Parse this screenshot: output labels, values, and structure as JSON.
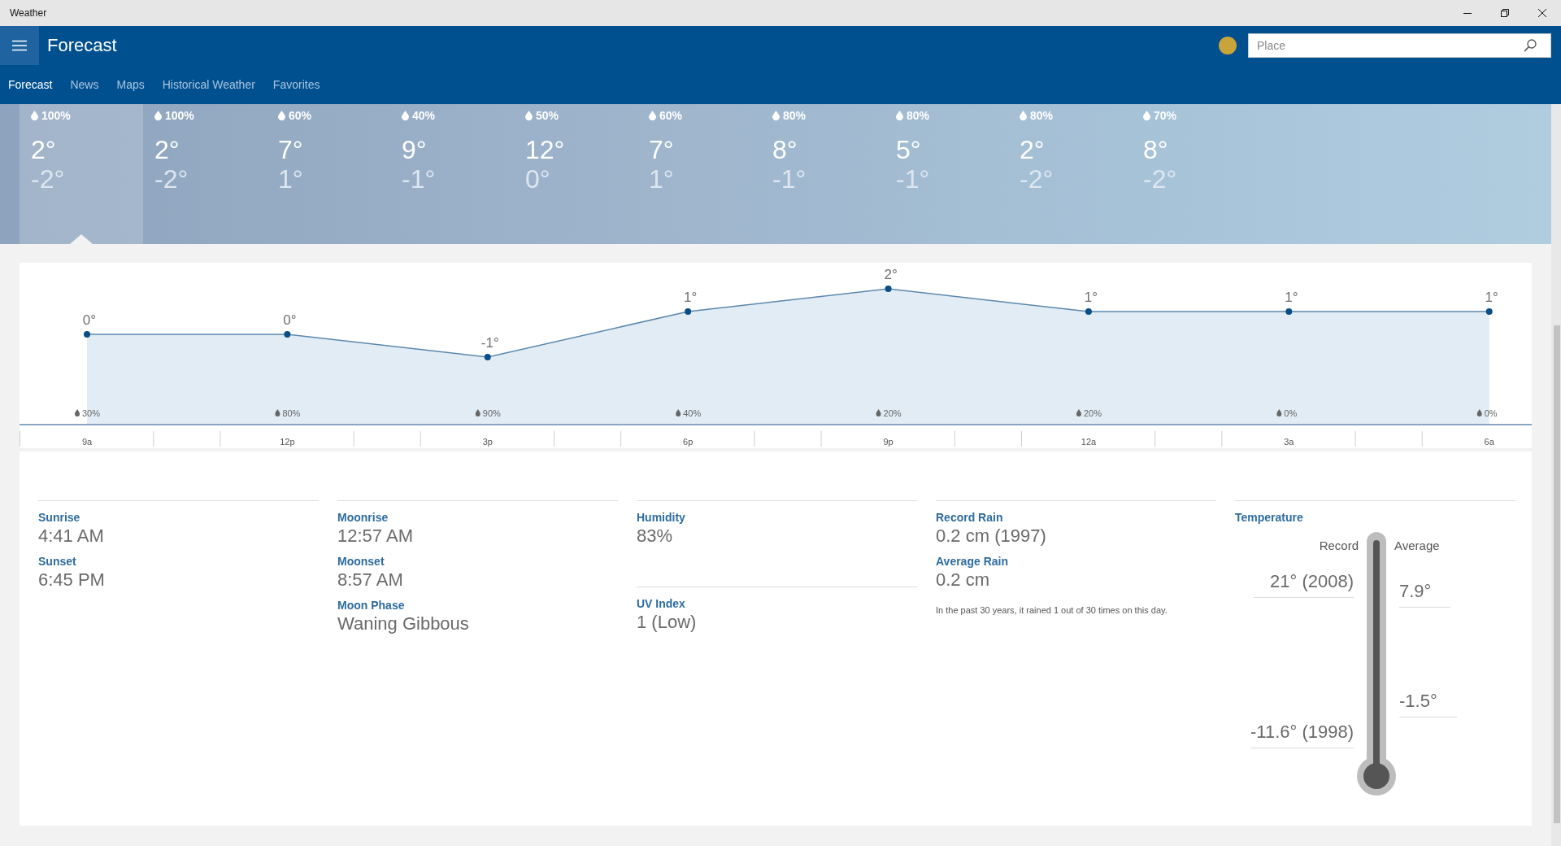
{
  "window": {
    "title": "Weather"
  },
  "header": {
    "title": "Forecast",
    "search": {
      "placeholder": "Place"
    }
  },
  "tabs": [
    {
      "label": "Forecast",
      "selected": true
    },
    {
      "label": "News",
      "selected": false
    },
    {
      "label": "Maps",
      "selected": false
    },
    {
      "label": "Historical Weather",
      "selected": false
    },
    {
      "label": "Favorites",
      "selected": false
    }
  ],
  "days": [
    {
      "precip": "100%",
      "high": "2°",
      "low": "-2°",
      "selected": true
    },
    {
      "precip": "100%",
      "high": "2°",
      "low": "-2°",
      "selected": false
    },
    {
      "precip": "60%",
      "high": "7°",
      "low": "1°",
      "selected": false
    },
    {
      "precip": "40%",
      "high": "9°",
      "low": "-1°",
      "selected": false
    },
    {
      "precip": "50%",
      "high": "12°",
      "low": "0°",
      "selected": false
    },
    {
      "precip": "60%",
      "high": "7°",
      "low": "1°",
      "selected": false
    },
    {
      "precip": "80%",
      "high": "8°",
      "low": "-1°",
      "selected": false
    },
    {
      "precip": "80%",
      "high": "5°",
      "low": "-1°",
      "selected": false
    },
    {
      "precip": "80%",
      "high": "2°",
      "low": "-2°",
      "selected": false
    },
    {
      "precip": "70%",
      "high": "8°",
      "low": "-2°",
      "selected": false
    }
  ],
  "hourly": {
    "chart_data": {
      "type": "area",
      "categories": [
        "9a",
        "12p",
        "3p",
        "6p",
        "9p",
        "12a",
        "3a",
        "6a"
      ],
      "series": [
        {
          "color": "#0b4d85",
          "values": [
            0,
            0,
            -1,
            1,
            2,
            1,
            1,
            1
          ]
        }
      ],
      "data_labels": true
    },
    "label_unit": "°",
    "precipitation": [
      "30%",
      "80%",
      "90%",
      "40%",
      "20%",
      "20%",
      "0%",
      "0%"
    ]
  },
  "details": {
    "columns": [
      {
        "groups": [
          [
            {
              "label": "Sunrise",
              "value": "4:41 AM"
            },
            {
              "label": "Sunset",
              "value": "6:45 PM"
            }
          ]
        ]
      },
      {
        "groups": [
          [
            {
              "label": "Moonrise",
              "value": "12:57 AM"
            },
            {
              "label": "Moonset",
              "value": "8:57 AM"
            },
            {
              "label": "Moon Phase",
              "value": "Waning Gibbous"
            }
          ]
        ]
      },
      {
        "groups": [
          [
            {
              "label": "Humidity",
              "value": "83%"
            }
          ],
          [
            {
              "label": "UV Index",
              "value": "1 (Low)"
            }
          ]
        ]
      },
      {
        "groups": [
          [
            {
              "label": "Record Rain",
              "value": "0.2 cm (1997)"
            },
            {
              "label": "Average Rain",
              "value": "0.2 cm"
            }
          ]
        ],
        "note": "In the past 30 years, it rained 1 out of 30 times on this day."
      }
    ],
    "temperature": {
      "title": "Temperature",
      "record_label": "Record",
      "average_label": "Average",
      "record_high": "21° (2008)",
      "record_low": "-11.6° (1998)",
      "average_high": "7.9°",
      "average_low": "-1.5°"
    }
  }
}
